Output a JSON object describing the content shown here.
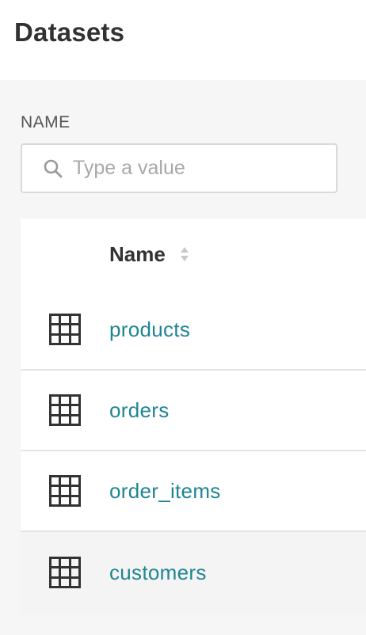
{
  "header": {
    "title": "Datasets"
  },
  "filter": {
    "label": "NAME",
    "placeholder": "Type a value",
    "value": ""
  },
  "table": {
    "column_name": "Name",
    "rows": [
      {
        "name": "products",
        "icon": "table-grid-icon"
      },
      {
        "name": "orders",
        "icon": "table-grid-icon"
      },
      {
        "name": "order_items",
        "icon": "table-grid-icon"
      },
      {
        "name": "customers",
        "icon": "table-grid-icon"
      }
    ]
  },
  "colors": {
    "link": "#1f8593",
    "title": "#323232",
    "background": "#f6f6f6"
  }
}
